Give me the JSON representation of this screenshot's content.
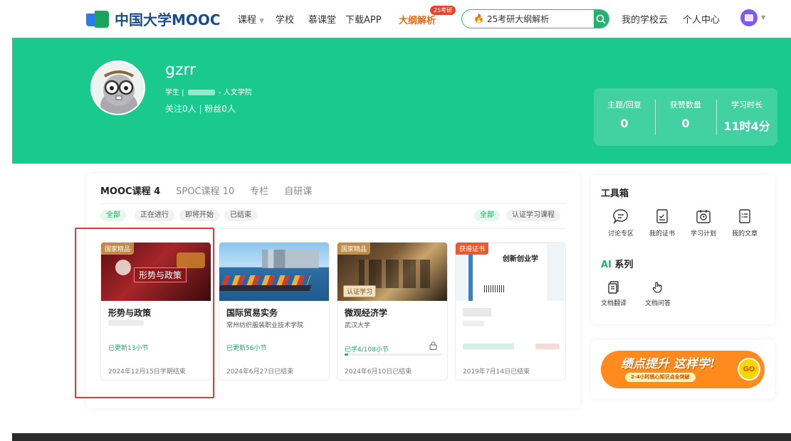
{
  "logo": {
    "text": "中国大学MOOC"
  },
  "nav": {
    "courses": "课程",
    "school": "学校",
    "mooc_hall": "慕课堂",
    "download": "下载APP",
    "promo": "大纲解析",
    "promo_badge": "25考研",
    "my_school_cloud": "我的学校云",
    "personal_center": "个人中心"
  },
  "search": {
    "value": "25考研大纲解析"
  },
  "profile": {
    "username": "gzrr",
    "role_prefix": "学生 |",
    "department": "- 人文学院",
    "follow_info": "关注0人 | 粉丝0人"
  },
  "stats": [
    {
      "label": "主题/回复",
      "value": "0"
    },
    {
      "label": "获赞数量",
      "value": "0"
    },
    {
      "label": "学习时长",
      "value": "11时4分"
    }
  ],
  "tabs": [
    "MOOC课程 4",
    "SPOC课程 10",
    "专栏",
    "自研课"
  ],
  "filters_left": [
    "全部",
    "正在进行",
    "即将开始",
    "已结束"
  ],
  "filters_right": [
    "全部",
    "认证学习课程"
  ],
  "courses": [
    {
      "tag": "国家精品",
      "banner": "形势与政策",
      "title": "形势与政策",
      "school": "",
      "progress": "已更新13小节",
      "date": "2024年12月15日学期结束"
    },
    {
      "tag": "",
      "title": "国际贸易实务",
      "school": "常州纺织服装职业技术学院",
      "progress": "已更新56小节",
      "date": "2024年6月27日已结束"
    },
    {
      "tag": "国家精品",
      "badge": "认证学习",
      "title": "微观经济学",
      "school": "武汉大学",
      "progress": "已学4/108小节",
      "progress_fraction": 0.04,
      "date": "2024年6月10日已结束"
    },
    {
      "tag": "获得证书",
      "book_title": "创新创业学",
      "title": "",
      "school": "",
      "progress": "",
      "date": "2019年7月14日已结束"
    }
  ],
  "toolbox": {
    "title": "工具箱",
    "tools": [
      "讨论专区",
      "我的证书",
      "学习计划",
      "我的文章"
    ],
    "ai_prefix": "AI",
    "ai_suffix": " 系列",
    "ai_tools": [
      "文档翻译",
      "文档问答"
    ]
  },
  "ad": {
    "title": "绩点提升 这样学!",
    "subtitle": "2-4小时核心知识点全突破",
    "go": "GO"
  },
  "colors": {
    "brand_green": "#19c98d",
    "accent_green": "#1ea866",
    "highlight_red": "#e23a3a"
  }
}
